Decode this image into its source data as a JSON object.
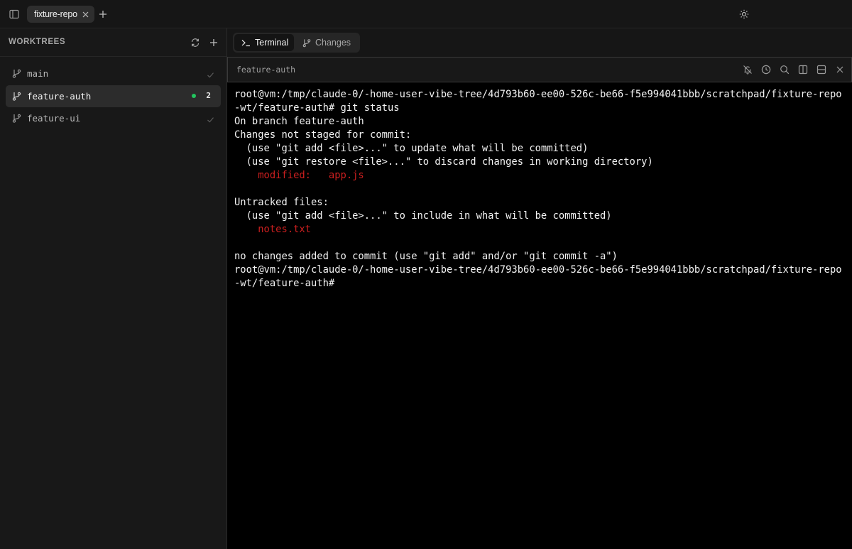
{
  "topbar": {
    "tab_label": "fixture-repo"
  },
  "sidebar": {
    "title": "WORKTREES",
    "items": [
      {
        "label": "main",
        "active": false
      },
      {
        "label": "feature-auth",
        "active": true,
        "count": "2"
      },
      {
        "label": "feature-ui",
        "active": false
      }
    ]
  },
  "main": {
    "tabs": [
      {
        "label": "Terminal"
      },
      {
        "label": "Changes"
      }
    ],
    "terminal_title": "feature-auth",
    "terminal_lines": [
      {
        "text": "root@vm:/tmp/claude-0/-home-user-vibe-tree/4d793b60-ee00-526c-be66-f5e994041bbb/scratchpad/fixture-repo"
      },
      {
        "text": "-wt/feature-auth# git status"
      },
      {
        "text": "On branch feature-auth"
      },
      {
        "text": "Changes not staged for commit:"
      },
      {
        "text": "  (use \"git add <file>...\" to update what will be committed)"
      },
      {
        "text": "  (use \"git restore <file>...\" to discard changes in working directory)"
      },
      {
        "text": "    modified:   app.js",
        "color": "red"
      },
      {
        "text": ""
      },
      {
        "text": "Untracked files:"
      },
      {
        "text": "  (use \"git add <file>...\" to include in what will be committed)"
      },
      {
        "text": "    notes.txt",
        "color": "red"
      },
      {
        "text": ""
      },
      {
        "text": "no changes added to commit (use \"git add\" and/or \"git commit -a\")"
      },
      {
        "text": "root@vm:/tmp/claude-0/-home-user-vibe-tree/4d793b60-ee00-526c-be66-f5e994041bbb/scratchpad/fixture-repo"
      },
      {
        "text": "-wt/feature-auth# "
      }
    ]
  },
  "colors": {
    "accent_dot": "#22c55e",
    "terminal_red": "#cc1f1f"
  }
}
